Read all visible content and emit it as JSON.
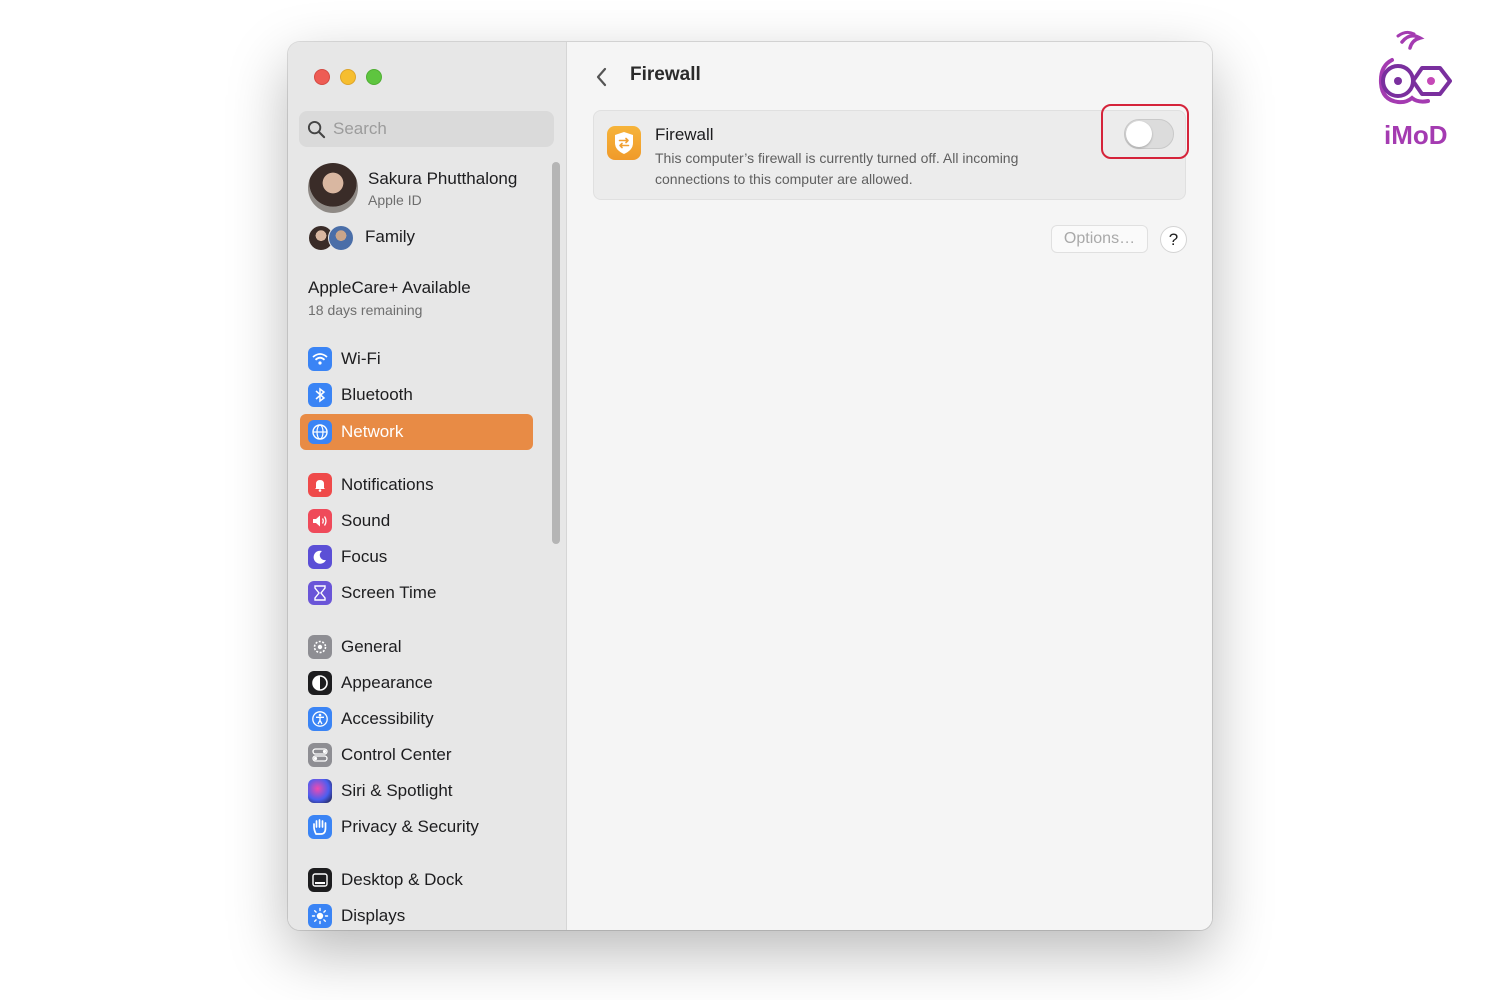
{
  "sidebar": {
    "search_placeholder": "Search",
    "profile": {
      "name": "Sakura Phutthalong",
      "subtitle": "Apple ID"
    },
    "family_label": "Family",
    "applecare": {
      "title": "AppleCare+ Available",
      "subtitle": "18 days remaining"
    },
    "items": [
      {
        "label": "Wi-Fi",
        "icon": "wifi-icon",
        "color": "#3a84f5"
      },
      {
        "label": "Bluetooth",
        "icon": "bluetooth-icon",
        "color": "#3a84f5"
      },
      {
        "label": "Network",
        "icon": "globe-icon",
        "color": "#3a84f5",
        "selected": true
      },
      {
        "label": "Notifications",
        "icon": "bell-icon",
        "color": "#ef4a4a"
      },
      {
        "label": "Sound",
        "icon": "speaker-icon",
        "color": "#ef4a5a"
      },
      {
        "label": "Focus",
        "icon": "moon-icon",
        "color": "#5b4fd6"
      },
      {
        "label": "Screen Time",
        "icon": "hourglass-icon",
        "color": "#6a55d8"
      },
      {
        "label": "General",
        "icon": "gear-icon",
        "color": "#8e8e93"
      },
      {
        "label": "Appearance",
        "icon": "appearance-icon",
        "color": "#1d1d1f"
      },
      {
        "label": "Accessibility",
        "icon": "accessibility-icon",
        "color": "#3a84f5"
      },
      {
        "label": "Control Center",
        "icon": "toggles-icon",
        "color": "#8e8e93"
      },
      {
        "label": "Siri & Spotlight",
        "icon": "siri-icon",
        "color": "#6b3fd0"
      },
      {
        "label": "Privacy & Security",
        "icon": "hand-icon",
        "color": "#3a84f5"
      },
      {
        "label": "Desktop & Dock",
        "icon": "dock-icon",
        "color": "#1d1d1f"
      },
      {
        "label": "Displays",
        "icon": "sun-icon",
        "color": "#3a84f5"
      }
    ],
    "selected_color": "#e88b45"
  },
  "main": {
    "title": "Firewall",
    "card": {
      "title": "Firewall",
      "description": "This computer’s firewall is currently turned off. All incoming connections to this computer are allowed.",
      "toggle_on": false
    },
    "options_label": "Options…",
    "help_label": "?"
  },
  "watermark": {
    "text": "iMoD"
  },
  "colors": {
    "highlight": "#d5233a",
    "accent": "#e88b45"
  }
}
